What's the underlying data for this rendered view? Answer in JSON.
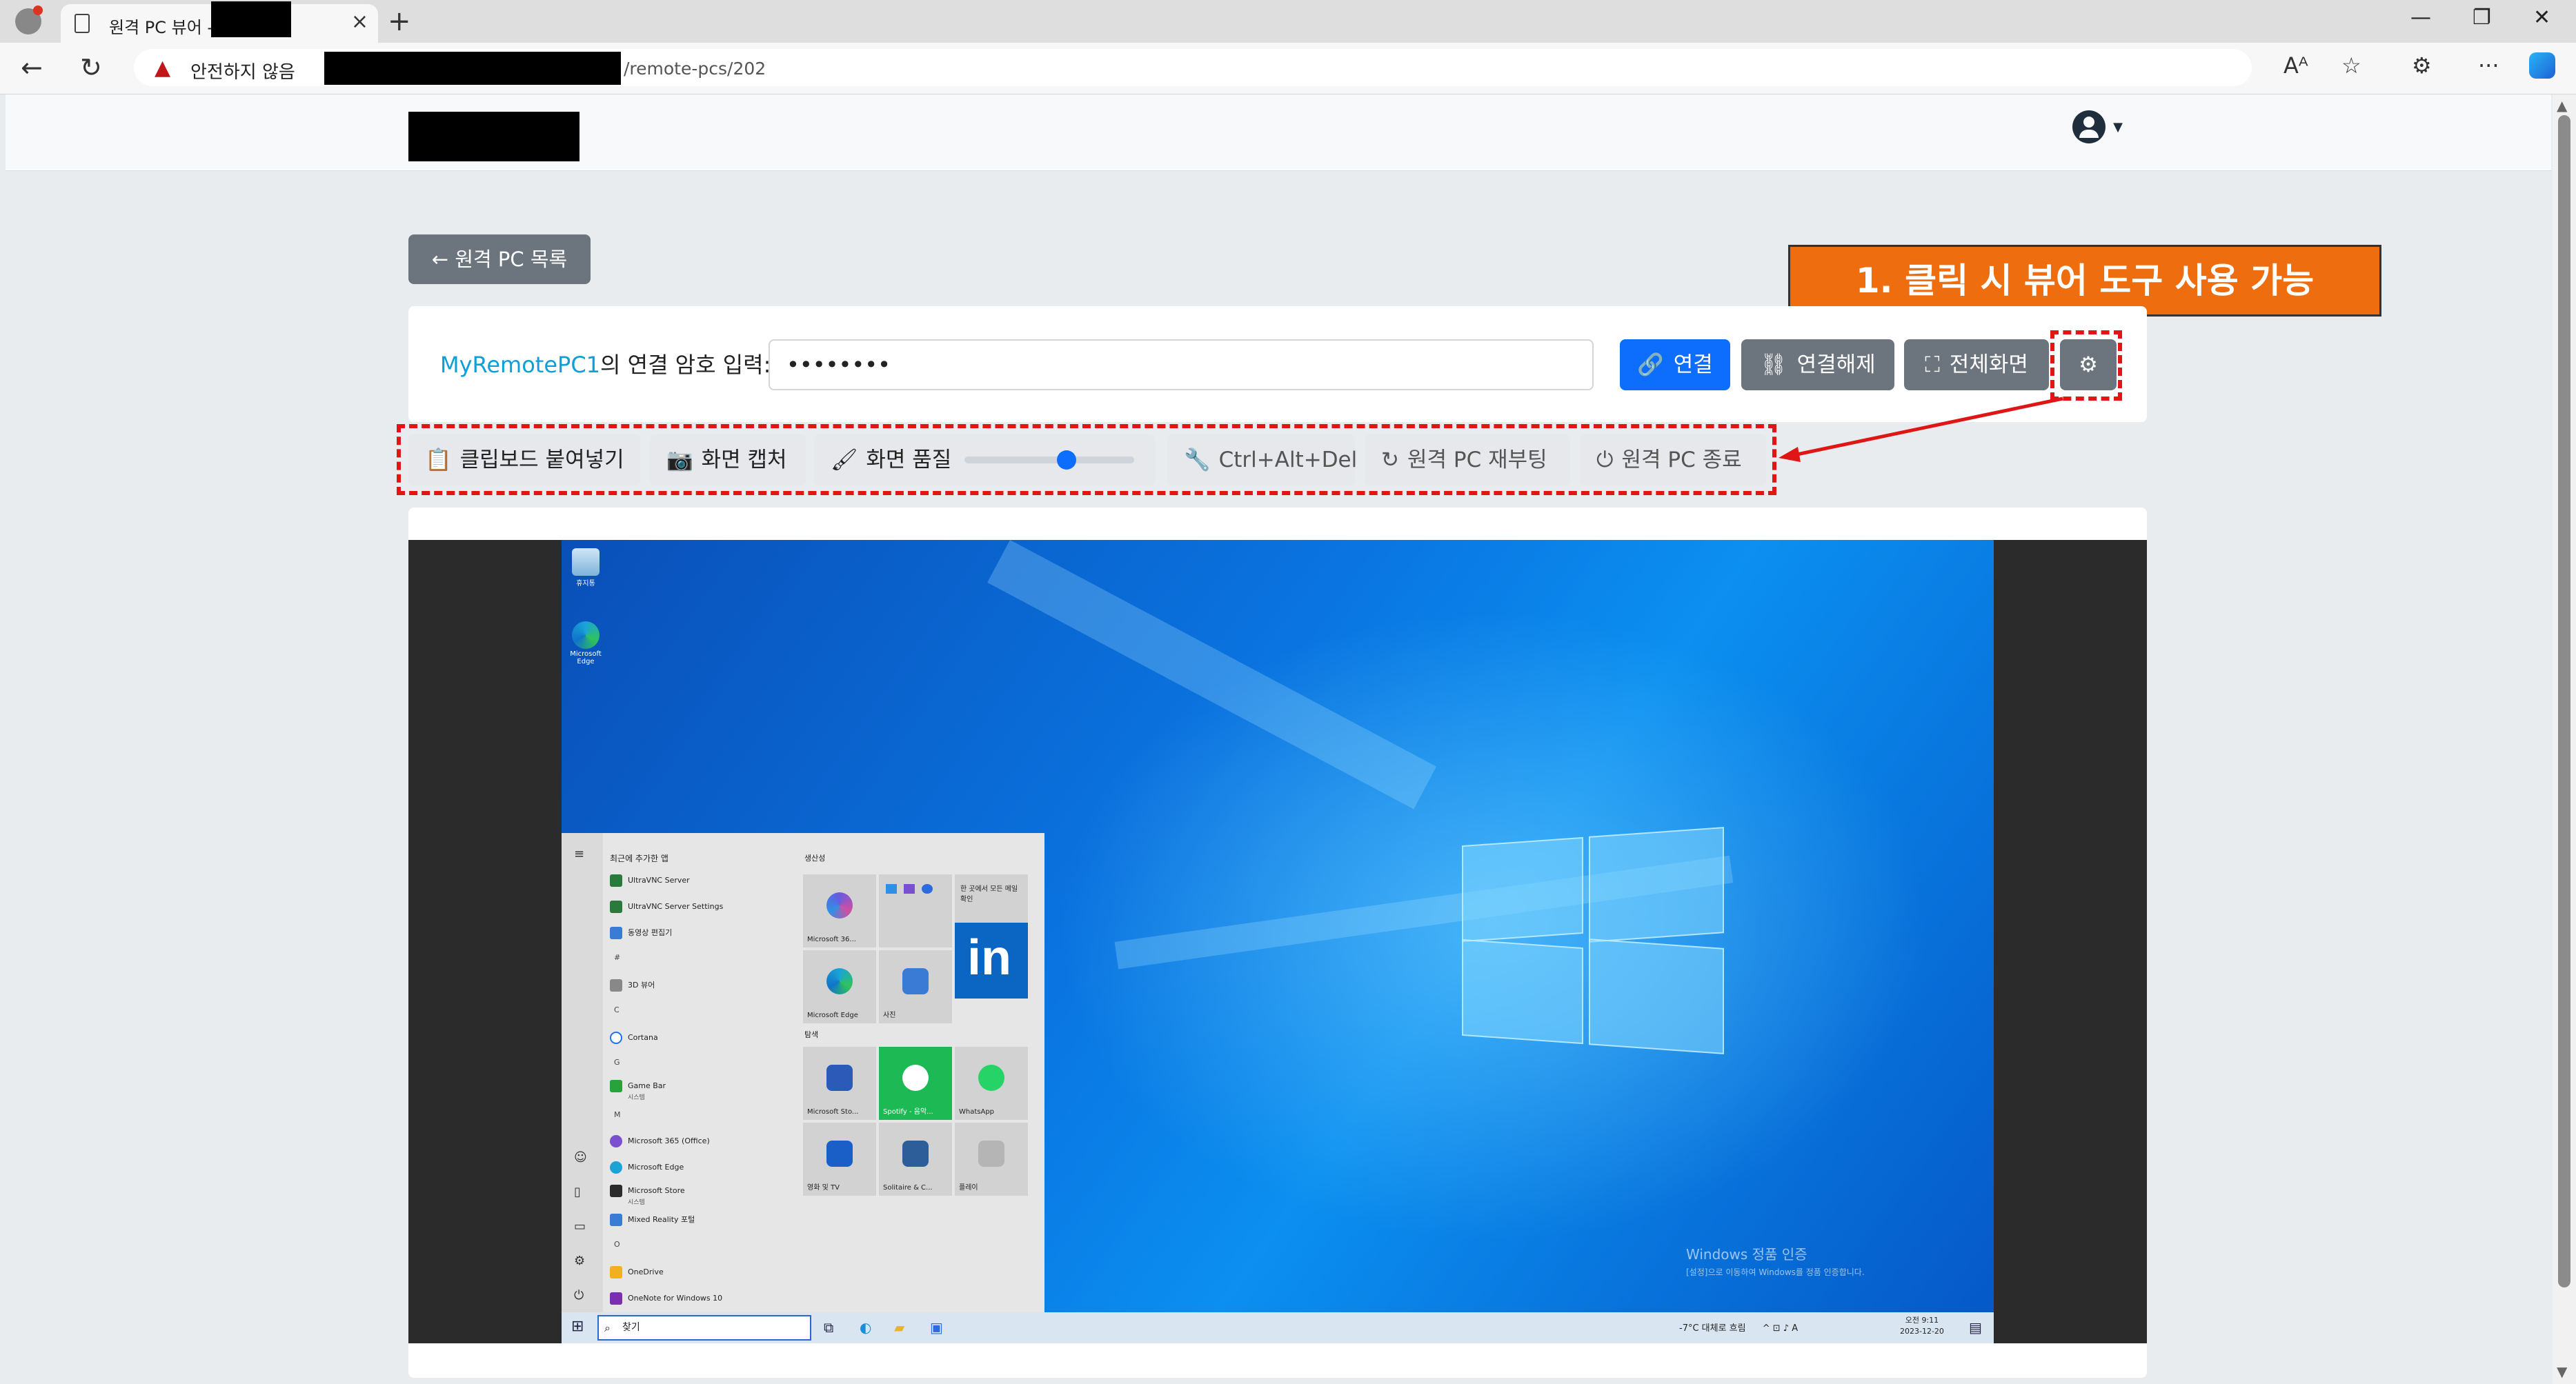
{
  "browser": {
    "tab_title": "원격 PC 뷰어 -",
    "address": {
      "warning": "안전하지 않음",
      "url_path": "/remote-pcs/202"
    },
    "icons": [
      "profile-icon",
      "page-icon",
      "close-icon",
      "plus-icon",
      "back-arrow-icon",
      "refresh-icon",
      "warning-icon",
      "read-aloud-icon",
      "favorite-star-icon",
      "extensions-icon",
      "more-icon",
      "copilot-icon"
    ],
    "window_controls": [
      "minimize",
      "restore",
      "close"
    ]
  },
  "header": {
    "user_menu_icon": "user-circle-icon"
  },
  "nav": {
    "back_label": "원격 PC 목록"
  },
  "callout": {
    "text": "1. 클릭 시 뷰어 도구 사용 가능"
  },
  "connect": {
    "pc_name": "MyRemotePC1",
    "label_suffix": "의 연결 암호 입력:",
    "password_mask": "••••••••",
    "connect_label": "연결",
    "disconnect_label": "연결해제",
    "fullscreen_label": "전체화면",
    "settings_icon": "gear-icon"
  },
  "toolbar": {
    "clipboard_label": "클립보드 붙여넣기",
    "capture_label": "화면 캡처",
    "quality_label": "화면 품질",
    "quality_value": 0.6,
    "cad_label": "Ctrl+Alt+Del",
    "reboot_label": "원격 PC 재부팅",
    "shutdown_label": "원격 PC 종료"
  },
  "remote_desktop": {
    "icons": [
      "recycle-bin",
      "microsoft-edge"
    ],
    "start_menu": {
      "recent_header": "최근에 추가한 앱",
      "productivity_group": "생산성",
      "explore_group": "탐색",
      "apps": [
        {
          "name": "UltraVNC Server"
        },
        {
          "name": "UltraVNC Server Settings"
        },
        {
          "name": "동영상 편집기"
        },
        {
          "letter": "#"
        },
        {
          "name": "3D 뷰어"
        },
        {
          "letter": "C"
        },
        {
          "name": "Cortana"
        },
        {
          "letter": "G"
        },
        {
          "name": "Game Bar",
          "sub": "시스템"
        },
        {
          "letter": "M"
        },
        {
          "name": "Microsoft 365 (Office)"
        },
        {
          "name": "Microsoft Edge"
        },
        {
          "name": "Microsoft Store",
          "sub": "시스템"
        },
        {
          "name": "Mixed Reality 포털"
        },
        {
          "letter": "O"
        },
        {
          "name": "OneDrive"
        },
        {
          "name": "OneNote for Windows 10"
        }
      ],
      "tiles": {
        "m365": "Microsoft 36...",
        "mail_text": "한 곳에서 모든 메일 확인",
        "mail": "메일",
        "edge": "Microsoft Edge",
        "photos": "사진",
        "store": "Microsoft Sto...",
        "spotify": "Spotify - 음악...",
        "whatsapp": "WhatsApp",
        "movies": "영화 및 TV",
        "solitaire": "Solitaire & C...",
        "play": "플레이"
      }
    },
    "taskbar": {
      "search_placeholder": "찾기",
      "weather": "-7°C  대체로 흐림",
      "ime": "A",
      "time": "오전 9:11",
      "date": "2023-12-20"
    },
    "watermark": {
      "title": "Windows 정품 인증",
      "subtitle": "[설정]으로 이동하여 Windows를 정품 인증합니다."
    }
  }
}
